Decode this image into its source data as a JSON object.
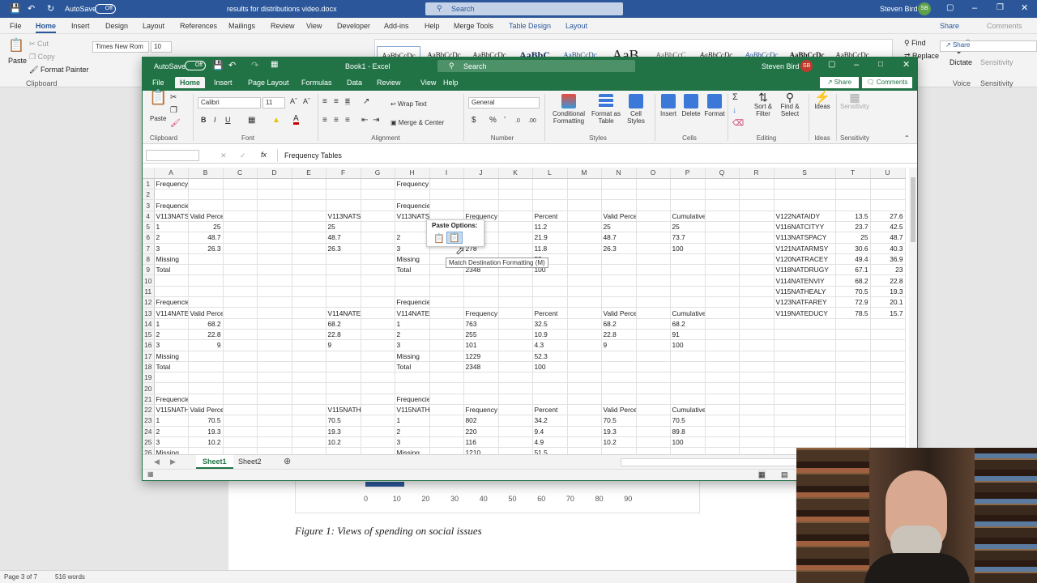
{
  "word": {
    "autosave": "AutoSave",
    "autosave_state": "Off",
    "doc_title": "results for distributions video.docx",
    "search_placeholder": "Search",
    "user": "Steven Bird",
    "initials": "SB",
    "tabs": [
      "File",
      "Home",
      "Insert",
      "Design",
      "Layout",
      "References",
      "Mailings",
      "Review",
      "View",
      "Developer",
      "Add-ins",
      "Help",
      "Merge Tools",
      "Table Design",
      "Layout"
    ],
    "share": "Share",
    "comments": "Comments",
    "clipboard": {
      "paste": "Paste",
      "cut": "Cut",
      "copy": "Copy",
      "format_painter": "Format Painter",
      "group": "Clipboard"
    },
    "font_name": "Times New Rom",
    "font_size": "10",
    "styles": [
      "AaBbCcDc",
      "AaBbCcDc",
      "AaBbCcDc",
      "AaBbC",
      "AaBbCcDc",
      "AaB",
      "AaBbCcC",
      "AaBbCcDc",
      "AaBbCcDc",
      "AaBbCcDc",
      "AaBbCcDc"
    ],
    "editing": {
      "find": "Find",
      "replace": "Replace"
    },
    "dictate": "Dictate",
    "voice": "Voice",
    "sensitivity": "Sensitivity",
    "axis_ticks": [
      "0",
      "10",
      "20",
      "30",
      "40",
      "50",
      "60",
      "70",
      "80",
      "90"
    ],
    "caption": "Figure 1: Views of spending on social issues",
    "status": {
      "page": "Page 3 of 7",
      "words": "516 words"
    }
  },
  "excel": {
    "autosave": "AutoSave",
    "autosave_state": "Off",
    "title": "Book1 - Excel",
    "search_placeholder": "Search",
    "user": "Steven Bird",
    "initials": "SB",
    "tabs": [
      "File",
      "Home",
      "Insert",
      "Page Layout",
      "Formulas",
      "Data",
      "Review",
      "View",
      "Help"
    ],
    "share": "Share",
    "comments": "Comments",
    "ribbon": {
      "paste": "Paste",
      "clipboard": "Clipboard",
      "font_name": "Calibri",
      "font_size": "11",
      "font": "Font",
      "alignment": "Alignment",
      "wrap_text": "Wrap Text",
      "merge_center": "Merge & Center",
      "number_format": "General",
      "number": "Number",
      "conditional": "Conditional Formatting",
      "format_table": "Format as Table",
      "cell_styles": "Cell Styles",
      "styles": "Styles",
      "insert": "Insert",
      "delete": "Delete",
      "format": "Format",
      "cells": "Cells",
      "sort_filter": "Sort & Filter",
      "find_select": "Find & Select",
      "editing": "Editing",
      "ideas": "Ideas",
      "ideas_group": "Ideas",
      "sensitivity": "Sensitivity",
      "sensitivity_group": "Sensitivity"
    },
    "formula_bar": {
      "name_box": "",
      "formula": "Frequency Tables",
      "fx": "fx"
    },
    "columns": [
      "A",
      "B",
      "C",
      "D",
      "E",
      "F",
      "G",
      "H",
      "I",
      "J",
      "K",
      "L",
      "M",
      "N",
      "O",
      "P",
      "Q",
      "R",
      "S",
      "T",
      "U"
    ],
    "rows": [
      [
        "1",
        "Frequency Tables",
        "",
        "",
        "",
        "",
        "",
        "",
        "Frequency Tables",
        "",
        "",
        "",
        "",
        "",
        "",
        "",
        "",
        "",
        "",
        "",
        "",
        ""
      ],
      [
        "2",
        "",
        "",
        "",
        "",
        "",
        "",
        "",
        "",
        "",
        "",
        "",
        "",
        "",
        "",
        "",
        "",
        "",
        "",
        "",
        "",
        ""
      ],
      [
        "3",
        "Frequencies for V113NATSPACY",
        "",
        "",
        "",
        "",
        "",
        "",
        "Frequencies for V113NATSPACY",
        "",
        "",
        "",
        "",
        "",
        "",
        "",
        "",
        "",
        "",
        "",
        "",
        ""
      ],
      [
        "4",
        "V113NATS",
        "Valid Percent",
        "",
        "",
        "",
        "V113NATSPACY",
        "",
        "V113NATSPACY",
        "",
        "Frequency",
        "",
        "Percent",
        "",
        "Valid Percent",
        "",
        "Cumulative Percent",
        "",
        "",
        "V122NATAIDY",
        "13.5",
        "27.6"
      ],
      [
        "5",
        "1",
        "25",
        "",
        "",
        "",
        "25",
        "",
        "",
        "",
        "",
        "",
        "11.2",
        "",
        "25",
        "",
        "25",
        "",
        "",
        "V116NATCITYY",
        "23.7",
        "42.5"
      ],
      [
        "6",
        "2",
        "48.7",
        "",
        "",
        "",
        "48.7",
        "",
        "2",
        "",
        "",
        "",
        "21.9",
        "",
        "48.7",
        "",
        "73.7",
        "",
        "",
        "V113NATSPACY",
        "25",
        "48.7"
      ],
      [
        "7",
        "3",
        "26.3",
        "",
        "",
        "",
        "26.3",
        "",
        "3",
        "",
        "278",
        "",
        "11.8",
        "",
        "26.3",
        "",
        "100",
        "",
        "",
        "V121NATARMSY",
        "30.6",
        "40.3"
      ],
      [
        "8",
        "Missing",
        "",
        "",
        "",
        "",
        "",
        "",
        "Missing",
        "",
        "",
        "",
        "55",
        "",
        "",
        "",
        "",
        "",
        "",
        "V120NATRACEY",
        "49.4",
        "36.9"
      ],
      [
        "9",
        "Total",
        "",
        "",
        "",
        "",
        "",
        "",
        "Total",
        "",
        "2348",
        "",
        "100",
        "",
        "",
        "",
        "",
        "",
        "",
        "V118NATDRUGY",
        "67.1",
        "23"
      ],
      [
        "10",
        "",
        "",
        "",
        "",
        "",
        "",
        "",
        "",
        "",
        "",
        "",
        "",
        "",
        "",
        "",
        "",
        "",
        "",
        "V114NATENVIY",
        "68.2",
        "22.8"
      ],
      [
        "11",
        "",
        "",
        "",
        "",
        "",
        "",
        "",
        "",
        "",
        "",
        "",
        "",
        "",
        "",
        "",
        "",
        "",
        "",
        "V115NATHEALY",
        "70.5",
        "19.3"
      ],
      [
        "12",
        "Frequencies for V114NATENVIY",
        "",
        "",
        "",
        "",
        "",
        "",
        "Frequencies for V114NATENVIY",
        "",
        "",
        "",
        "",
        "",
        "",
        "",
        "",
        "",
        "",
        "V123NATFAREY",
        "72.9",
        "20.1"
      ],
      [
        "13",
        "V114NATE",
        "Valid Percent",
        "",
        "",
        "",
        "V114NATENVIY",
        "",
        "V114NATENVIY",
        "",
        "Frequency",
        "",
        "Percent",
        "",
        "Valid Percent",
        "",
        "Cumulative Percent",
        "",
        "",
        "V119NATEDUCY",
        "78.5",
        "15.7"
      ],
      [
        "14",
        "1",
        "68.2",
        "",
        "",
        "",
        "68.2",
        "",
        "1",
        "",
        "763",
        "",
        "32.5",
        "",
        "68.2",
        "",
        "68.2",
        "",
        "",
        "",
        "",
        ""
      ],
      [
        "15",
        "2",
        "22.8",
        "",
        "",
        "",
        "22.8",
        "",
        "2",
        "",
        "255",
        "",
        "10.9",
        "",
        "22.8",
        "",
        "91",
        "",
        "",
        "",
        "",
        ""
      ],
      [
        "16",
        "3",
        "9",
        "",
        "",
        "",
        "9",
        "",
        "3",
        "",
        "101",
        "",
        "4.3",
        "",
        "9",
        "",
        "100",
        "",
        "",
        "",
        "",
        ""
      ],
      [
        "17",
        "Missing",
        "",
        "",
        "",
        "",
        "",
        "",
        "Missing",
        "",
        "1229",
        "",
        "52.3",
        "",
        "",
        "",
        "",
        "",
        "",
        "",
        "",
        ""
      ],
      [
        "18",
        "Total",
        "",
        "",
        "",
        "",
        "",
        "",
        "Total",
        "",
        "2348",
        "",
        "100",
        "",
        "",
        "",
        "",
        "",
        "",
        "",
        "",
        ""
      ],
      [
        "19",
        "",
        "",
        "",
        "",
        "",
        "",
        "",
        "",
        "",
        "",
        "",
        "",
        "",
        "",
        "",
        "",
        "",
        "",
        "",
        "",
        ""
      ],
      [
        "20",
        "",
        "",
        "",
        "",
        "",
        "",
        "",
        "",
        "",
        "",
        "",
        "",
        "",
        "",
        "",
        "",
        "",
        "",
        "",
        "",
        ""
      ],
      [
        "21",
        "Frequencies for V115NATHEALY",
        "",
        "",
        "",
        "",
        "",
        "",
        "Frequencies for V115NATHEALY",
        "",
        "",
        "",
        "",
        "",
        "",
        "",
        "",
        "",
        "",
        "",
        "",
        ""
      ],
      [
        "22",
        "V115NATH",
        "Valid Percent",
        "",
        "",
        "",
        "V115NATHEALY",
        "",
        "V115NATHEALY",
        "",
        "Frequency",
        "",
        "Percent",
        "",
        "Valid Percent",
        "",
        "Cumulative Percent",
        "",
        "",
        "",
        "",
        ""
      ],
      [
        "23",
        "1",
        "70.5",
        "",
        "",
        "",
        "70.5",
        "",
        "1",
        "",
        "802",
        "",
        "34.2",
        "",
        "70.5",
        "",
        "70.5",
        "",
        "",
        "",
        "",
        ""
      ],
      [
        "24",
        "2",
        "19.3",
        "",
        "",
        "",
        "19.3",
        "",
        "2",
        "",
        "220",
        "",
        "9.4",
        "",
        "19.3",
        "",
        "89.8",
        "",
        "",
        "",
        "",
        ""
      ],
      [
        "25",
        "3",
        "10.2",
        "",
        "",
        "",
        "10.2",
        "",
        "3",
        "",
        "116",
        "",
        "4.9",
        "",
        "10.2",
        "",
        "100",
        "",
        "",
        "",
        "",
        ""
      ],
      [
        "26",
        "Missing",
        "",
        "",
        "",
        "",
        "",
        "",
        "Missing",
        "",
        "1210",
        "",
        "51.5",
        "",
        "",
        "",
        "",
        "",
        "",
        "",
        "",
        ""
      ]
    ],
    "numeric_cols": [
      2,
      3,
      7,
      9,
      11,
      13,
      15,
      17,
      20,
      21
    ],
    "sheets": [
      "Sheet1",
      "Sheet2"
    ],
    "active_sheet": "Sheet1",
    "paste_options": {
      "title": "Paste Options:",
      "tooltip": "Match Destination Formatting (M)"
    }
  },
  "colors": {
    "word": "#2b579a",
    "excel": "#217346"
  }
}
